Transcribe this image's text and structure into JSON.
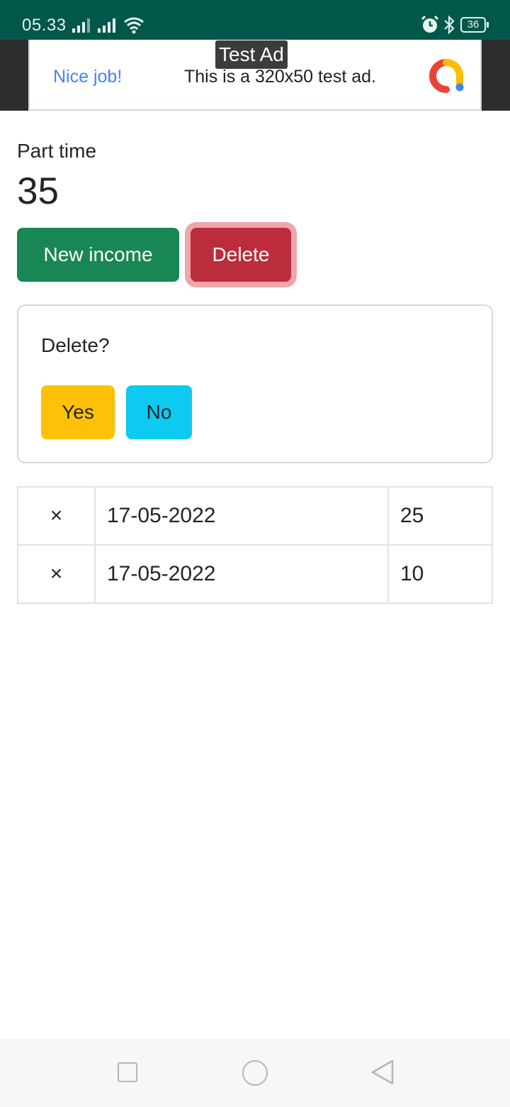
{
  "status_bar": {
    "time": "05.33",
    "battery": "36",
    "icons": [
      "signal-icon",
      "signal-icon",
      "wifi-icon",
      "alarm-icon",
      "bluetooth-icon",
      "battery-icon"
    ]
  },
  "ad": {
    "title": "Test Ad",
    "nice_job": "Nice job!",
    "text": "This is a 320x50 test ad.",
    "logo": "admob-logo"
  },
  "category": {
    "name": "Part time",
    "total": "35"
  },
  "actions": {
    "new_income": "New income",
    "delete": "Delete"
  },
  "confirm": {
    "question": "Delete?",
    "yes": "Yes",
    "no": "No"
  },
  "entries": [
    {
      "remove": "×",
      "date": "17-05-2022",
      "amount": "25"
    },
    {
      "remove": "×",
      "date": "17-05-2022",
      "amount": "10"
    }
  ],
  "colors": {
    "status_bar": "#01574a",
    "success": "#198754",
    "danger": "#bb2d3b",
    "warning": "#ffc107",
    "info": "#0dcaf0"
  },
  "nav_bar": {
    "icons": [
      "recents-square-icon",
      "home-circle-icon",
      "back-triangle-icon"
    ]
  }
}
